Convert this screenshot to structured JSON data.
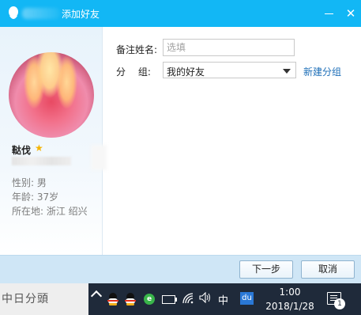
{
  "window": {
    "title": "添加好友",
    "minimize_glyph": "—",
    "close_glyph": "✕"
  },
  "profile": {
    "nickname": "鞑伐",
    "star_icon": "star-icon",
    "gender": "性别: 男",
    "age": "年龄: 37岁",
    "location": "所在地: 浙江  绍兴"
  },
  "form": {
    "remark_label": "备注姓名:",
    "remark_placeholder": "选填",
    "group_label": "分　 组:",
    "group_value": "我的好友",
    "new_group_link": "新建分组"
  },
  "buttons": {
    "next": "下一步",
    "cancel": "取消"
  },
  "taskbar": {
    "ime": "中",
    "baidu": "du",
    "time": "1:00",
    "date": "2018/1/28",
    "notification_count": "1",
    "behind_text": "中日分頭"
  },
  "colors": {
    "titlebar": "#12b7f5",
    "footer": "#cfe6f6",
    "link": "#1e6fb8",
    "taskbar": "#1f2a3a"
  }
}
